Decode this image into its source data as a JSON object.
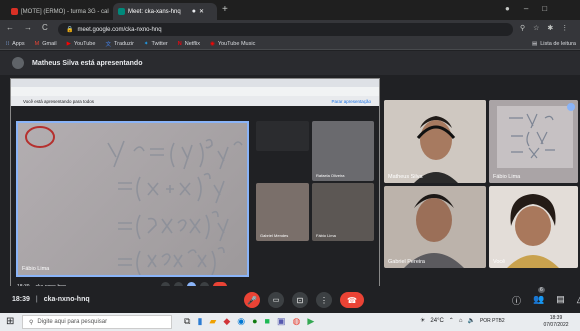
{
  "browser": {
    "tabs": [
      {
        "label": "[MOTE] (ERMO) - turma 3G - cal",
        "active": false,
        "fav": "#d93025"
      },
      {
        "label": "Meet: cka-xans-hnq",
        "active": true,
        "fav": "#00897b"
      }
    ],
    "url": "meet.google.com/cka-nxno-hnq",
    "bookmarks": [
      "Apps",
      "Gmail",
      "YouTube",
      "Traduzir",
      "Twitter",
      "Netflix",
      "YouTube Music"
    ],
    "reading_list": "Lista de leitura"
  },
  "banner": {
    "text": "Matheus Silva está apresentando"
  },
  "presentation": {
    "notice": "Você está apresentando para todos",
    "stop_label": "Parar apresentação",
    "board_label": "Fábio Lima",
    "board_lines": [
      "y'' = (y'')''y'",
      "=(x+ x)''y'",
      "=(x²yx²)''y'",
      "=(x²xux²)''"
    ],
    "board_tag": "(4)",
    "meeting_code": "cka-nxno-hnq",
    "time": "18:39",
    "side_names": [
      "Rafaela Oliveira",
      "Gabriel Mendes",
      "Fábio Lima"
    ],
    "taskbar_search": "Digite aqui para pesquisar"
  },
  "participants": [
    {
      "name": "Matheus Silva"
    },
    {
      "name": "Fábio Lima"
    },
    {
      "name": "Gabriel Pereira"
    },
    {
      "name": "Você"
    }
  ],
  "controls": {
    "time": "18:39",
    "meeting_code": "cka-nxno-hnq",
    "participant_count": "6"
  },
  "taskbar": {
    "search_placeholder": "Digite aqui para pesquisar",
    "weather": "24°C",
    "lang": "POR PTB2",
    "clock_time": "18:39",
    "clock_date": "07/07/2022"
  }
}
